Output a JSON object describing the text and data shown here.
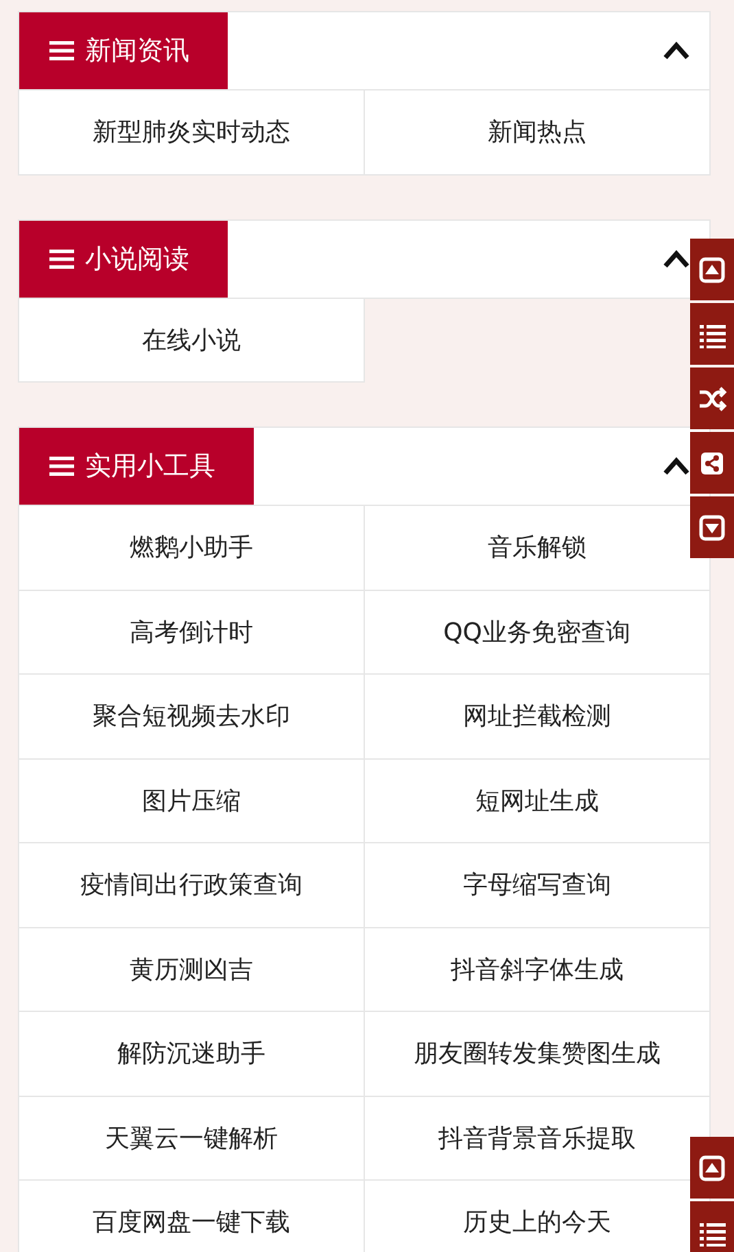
{
  "sections": [
    {
      "title": "新闻资讯",
      "expanded": true,
      "items": [
        "新型肺炎实时动态",
        "新闻热点"
      ]
    },
    {
      "title": "小说阅读",
      "expanded": true,
      "items": [
        "在线小说"
      ]
    },
    {
      "title": "实用小工具",
      "expanded": true,
      "items": [
        "燃鹅小助手",
        "音乐解锁",
        "高考倒计时",
        "QQ业务免密查询",
        "聚合短视频去水印",
        "网址拦截检测",
        "图片压缩",
        "短网址生成",
        "疫情间出行政策查询",
        "字母缩写查询",
        "黄历测凶吉",
        "抖音斜字体生成",
        "解防沉迷助手",
        "朋友圈转发集赞图生成",
        "天翼云一键解析",
        "抖音背景音乐提取",
        "百度网盘一键下载",
        "历史上的今天"
      ]
    }
  ]
}
